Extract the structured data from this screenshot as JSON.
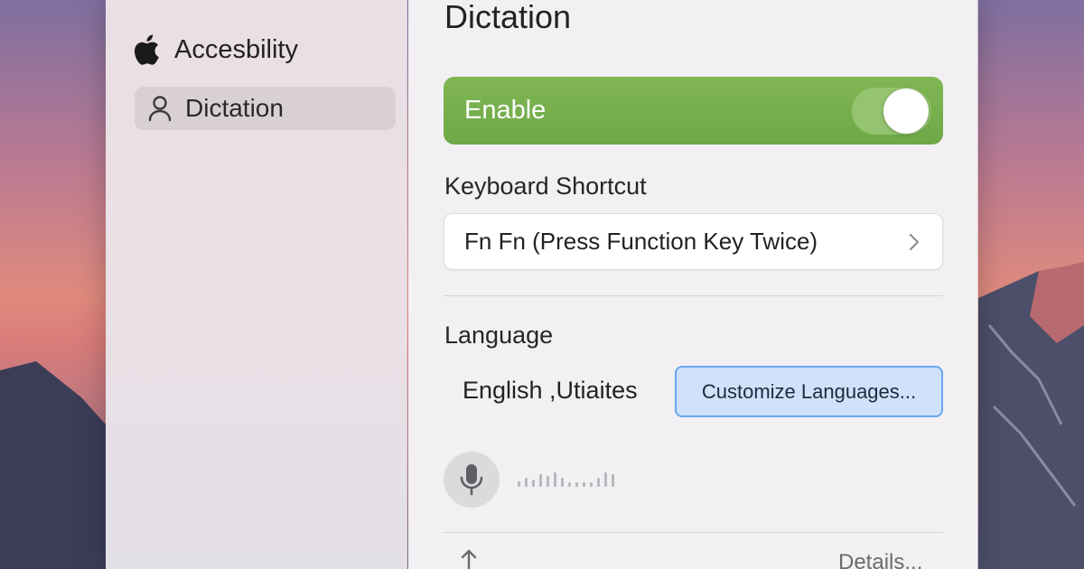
{
  "sidebar": {
    "header_label": "Accesbility",
    "header_icon": "apple-logo-icon",
    "items": [
      {
        "label": "Dictation",
        "icon": "user-icon",
        "selected": true
      }
    ]
  },
  "main": {
    "title": "Dictation",
    "enable": {
      "label": "Enable",
      "on": true,
      "accent": "#6ea947"
    },
    "keyboard_shortcut": {
      "heading": "Keyboard Shortcut",
      "value": "Fn Fn (Press Function Key Twice)"
    },
    "language": {
      "heading": "Language",
      "value": "English ,Utiaites",
      "button_label": "Customize Languages..."
    },
    "details_link": "Details..."
  }
}
